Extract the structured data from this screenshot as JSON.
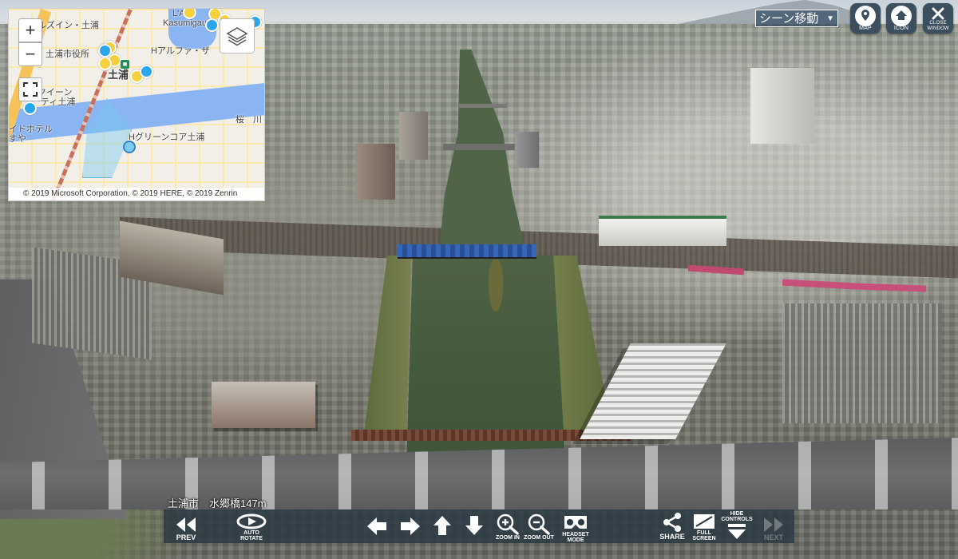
{
  "map": {
    "zoom_in_label": "+",
    "zoom_out_label": "−",
    "labels": {
      "hotel_top": "ルズイン・土浦",
      "kasumigaura": "Kasumigaura",
      "kasumigaura_prefix": "L'A",
      "city_office": "土浦市役所",
      "tsuchiura": "土浦",
      "h_alpha": "Hアルファ・ザ",
      "queen": "クイーン",
      "city_tsuchiura": "ティ土浦",
      "hotel_left": "イドホテル",
      "hotel_left_2": "すや",
      "green_core": "Hグリーンコア土浦",
      "sakura": "桜　川"
    },
    "copyright": "© 2019 Microsoft Corporation, © 2019 HERE, © 2019 Zenrin"
  },
  "scene_select": {
    "label": "シーン移動",
    "arrow": "▼"
  },
  "top_buttons": {
    "map": "MAP",
    "icon": "ICON",
    "close_line1": "CLOSE",
    "close_line2": "WINDOW"
  },
  "location_caption": "土浦市　水郷橋147m",
  "toolbar": {
    "prev": "PREV",
    "auto_rotate_1": "AUTO",
    "auto_rotate_2": "ROTATE",
    "zoom_in": "ZOOM IN",
    "zoom_out": "ZOOM OUT",
    "headset_1": "HEADSET",
    "headset_2": "MODE",
    "share": "SHARE",
    "full_1": "FULL",
    "full_2": "SCREEN",
    "hide_1": "HIDE",
    "hide_2": "CONTROLS",
    "next": "NEXT"
  },
  "colors": {
    "toolbar_bg": "#28373f",
    "map_water": "#8ab4f2",
    "map_pin_yellow": "#f5d23c",
    "map_pin_blue": "#2aa7ec",
    "bridge_blue": "#3566b8"
  }
}
